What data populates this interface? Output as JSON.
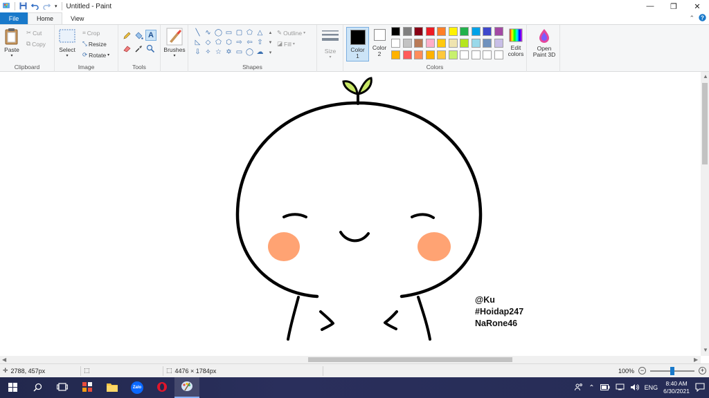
{
  "window": {
    "title": "Untitled - Paint",
    "minimize": "—",
    "restore": "❐",
    "close": "✕"
  },
  "tabs": [
    {
      "label": "File"
    },
    {
      "label": "Home"
    },
    {
      "label": "View"
    }
  ],
  "help_glyph": "?",
  "ribbon": {
    "clipboard": {
      "label": "Clipboard",
      "paste": "Paste",
      "cut": "Cut",
      "copy": "Copy"
    },
    "image": {
      "label": "Image",
      "select": "Select",
      "crop": "Crop",
      "resize": "Resize",
      "rotate": "Rotate"
    },
    "tools": {
      "label": "Tools"
    },
    "brushes": {
      "label": "Brushes"
    },
    "shapes": {
      "label": "Shapes",
      "outline": "Outline",
      "fill": "Fill"
    },
    "size": {
      "label": "Size"
    },
    "colors": {
      "label": "Colors",
      "color1": "Color 1",
      "color2": "Color 2",
      "color1_value": "#000000",
      "color2_value": "#ffffff",
      "edit_colors": "Edit colors",
      "palette": [
        "#000000",
        "#7f7f7f",
        "#880015",
        "#ed1c24",
        "#ff7f27",
        "#fff200",
        "#22b14c",
        "#00a2e8",
        "#3f48cc",
        "#a349a4",
        "#ffffff",
        "#c3c3c3",
        "#b97a57",
        "#ffaec9",
        "#ffc90e",
        "#efe4b0",
        "#b5e61d",
        "#99d9ea",
        "#7092be",
        "#c8bfe7",
        "#ffb200",
        "#ff5a5a",
        "#ff8c5a",
        "#ffb200",
        "#ffc83c",
        "#c8f06e",
        "#ffffff",
        "#ffffff",
        "#ffffff",
        "#ffffff"
      ]
    },
    "paint3d": {
      "label": "Open Paint 3D"
    }
  },
  "canvas": {
    "signature": [
      "@Ku",
      "#Hoidap247",
      "NaRone46"
    ],
    "colors": {
      "stroke": "#000000",
      "blush": "#ffa373",
      "sprout_leaf": "#c9e866"
    }
  },
  "status": {
    "cursor_pos": "2788, 457px",
    "selection_size": "",
    "image_size": "4476 × 1784px",
    "zoom": "100%",
    "zoom_fraction": 0.5
  },
  "taskbar": {
    "language": "ENG",
    "time": "8:40 AM",
    "date": "6/30/2021",
    "zalo": "Zalo"
  }
}
